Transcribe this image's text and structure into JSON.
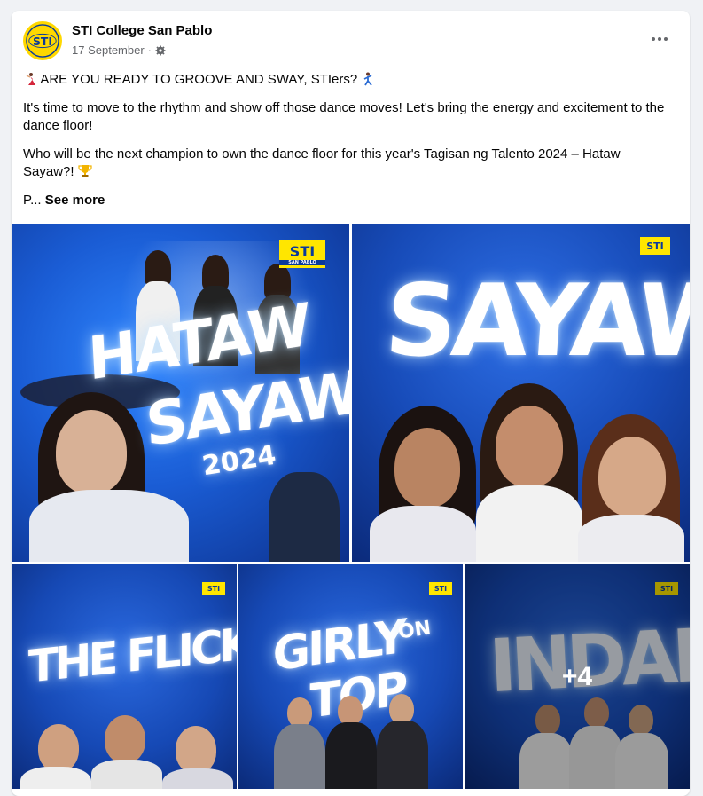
{
  "post": {
    "author": "STI College San Pablo",
    "date": "17 September",
    "date_sep": "·",
    "avatar_text": "STI",
    "paragraphs": {
      "p1": "ARE YOU READY TO GROOVE AND SWAY, STIers?",
      "p2": "It's time to move to the rhythm and show off those dance moves! Let's bring the energy and excitement to the dance floor!",
      "p3": "Who will be the next champion to own the dance floor for this year's Tagisan ng Talento 2024 – Hataw Sayaw?!",
      "p4_prefix": "P...",
      "see_more": "See more"
    }
  },
  "photos": {
    "tile1": {
      "line1": "HATAW",
      "line2": "SAYAW",
      "line3": "2024",
      "logo": "STI",
      "logo_sub": "SAN PABLO"
    },
    "tile2": {
      "title": "SAYAWE",
      "logo": "STI"
    },
    "tile3": {
      "title": "THE FLICKER",
      "logo": "STI"
    },
    "tile4": {
      "line1": "GIRLY",
      "on": "ON",
      "line2": "TOP",
      "logo": "STI"
    },
    "tile5": {
      "title": "INDAKS",
      "logo": "STI",
      "more_count": "+4"
    }
  },
  "colors": {
    "accent_blue": "#1a5cd4",
    "brand_yellow": "#ffe600",
    "muted_text": "#65676b"
  },
  "icons": {
    "privacy": "gear-icon",
    "menu": "more-options-icon",
    "emoji1": "dancer-woman-emoji",
    "emoji2": "dancer-man-emoji",
    "emoji3": "trophy-emoji"
  }
}
